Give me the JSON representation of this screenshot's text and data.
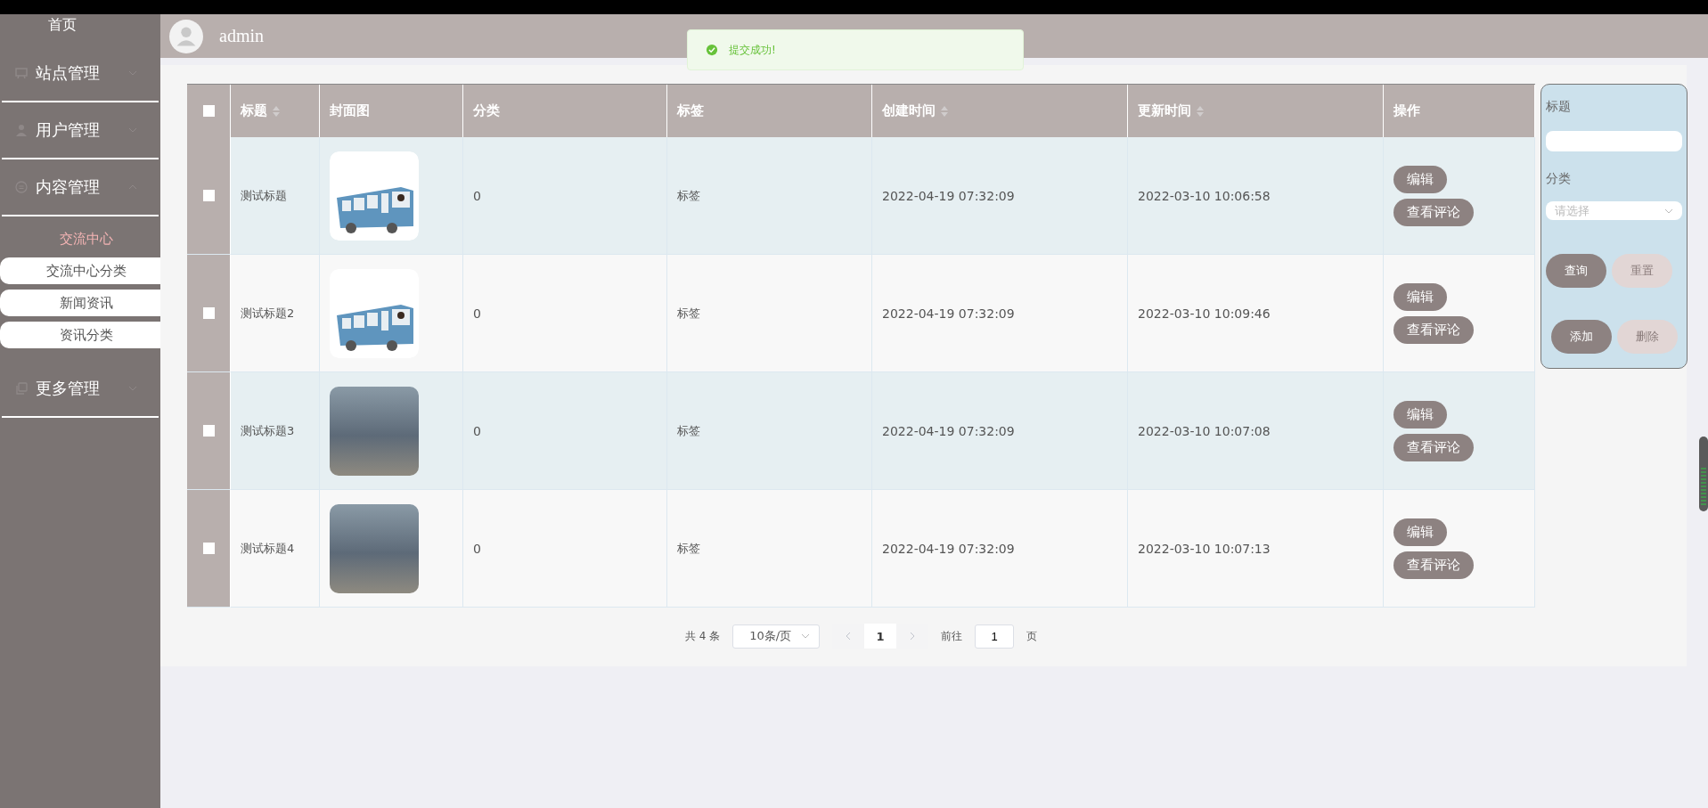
{
  "sidebar": {
    "home": "首页",
    "menus": [
      {
        "label": "站点管理",
        "expanded": false
      },
      {
        "label": "用户管理",
        "expanded": false
      },
      {
        "label": "内容管理",
        "expanded": true,
        "children": [
          {
            "label": "交流中心",
            "selected": true
          },
          {
            "label": "交流中心分类",
            "selected": false
          },
          {
            "label": "新闻资讯",
            "selected": false
          },
          {
            "label": "资讯分类",
            "selected": false
          }
        ]
      },
      {
        "label": "更多管理",
        "expanded": false
      }
    ]
  },
  "header": {
    "username": "admin"
  },
  "toast": {
    "message": "提交成功!"
  },
  "table": {
    "select_all_checked": false,
    "columns": [
      {
        "label": "标题",
        "sortable": true
      },
      {
        "label": "封面图",
        "sortable": false
      },
      {
        "label": "分类",
        "sortable": false
      },
      {
        "label": "标签",
        "sortable": false
      },
      {
        "label": "创建时间",
        "sortable": true
      },
      {
        "label": "更新时间",
        "sortable": true
      },
      {
        "label": "操作",
        "sortable": false
      }
    ],
    "rows": [
      {
        "checked": false,
        "title": "测试标题",
        "kind": "illustration",
        "category": "0",
        "tag": "标签",
        "created": "2022-04-19 07:32:09",
        "updated": "2022-03-10 10:06:58",
        "actions": [
          "编辑",
          "查看评论"
        ]
      },
      {
        "checked": false,
        "title": "测试标题2",
        "kind": "illustration",
        "category": "0",
        "tag": "标签",
        "created": "2022-04-19 07:32:09",
        "updated": "2022-03-10 10:09:46",
        "actions": [
          "编辑",
          "查看评论"
        ]
      },
      {
        "checked": false,
        "title": "测试标题3",
        "kind": "photo",
        "category": "0",
        "tag": "标签",
        "created": "2022-04-19 07:32:09",
        "updated": "2022-03-10 10:07:08",
        "actions": [
          "编辑",
          "查看评论"
        ]
      },
      {
        "checked": false,
        "title": "测试标题4",
        "kind": "photo",
        "category": "0",
        "tag": "标签",
        "created": "2022-04-19 07:32:09",
        "updated": "2022-03-10 10:07:13",
        "actions": [
          "编辑",
          "查看评论"
        ]
      }
    ]
  },
  "pagination": {
    "total": "共 4 条",
    "page_size": "10条/页",
    "pages": [
      {
        "label": "1",
        "selected": true
      }
    ],
    "goto_label": "前往",
    "goto_value": "1",
    "page_suffix": "页"
  },
  "search_panel": {
    "title_label": "标题",
    "category_label": "分类",
    "category_placeholder": "请选择",
    "buttons": [
      {
        "label": "查询",
        "disabled": false
      },
      {
        "label": "重置",
        "disabled": true
      },
      {
        "label": "添加",
        "disabled": false
      },
      {
        "label": "删除",
        "disabled": true
      }
    ]
  }
}
